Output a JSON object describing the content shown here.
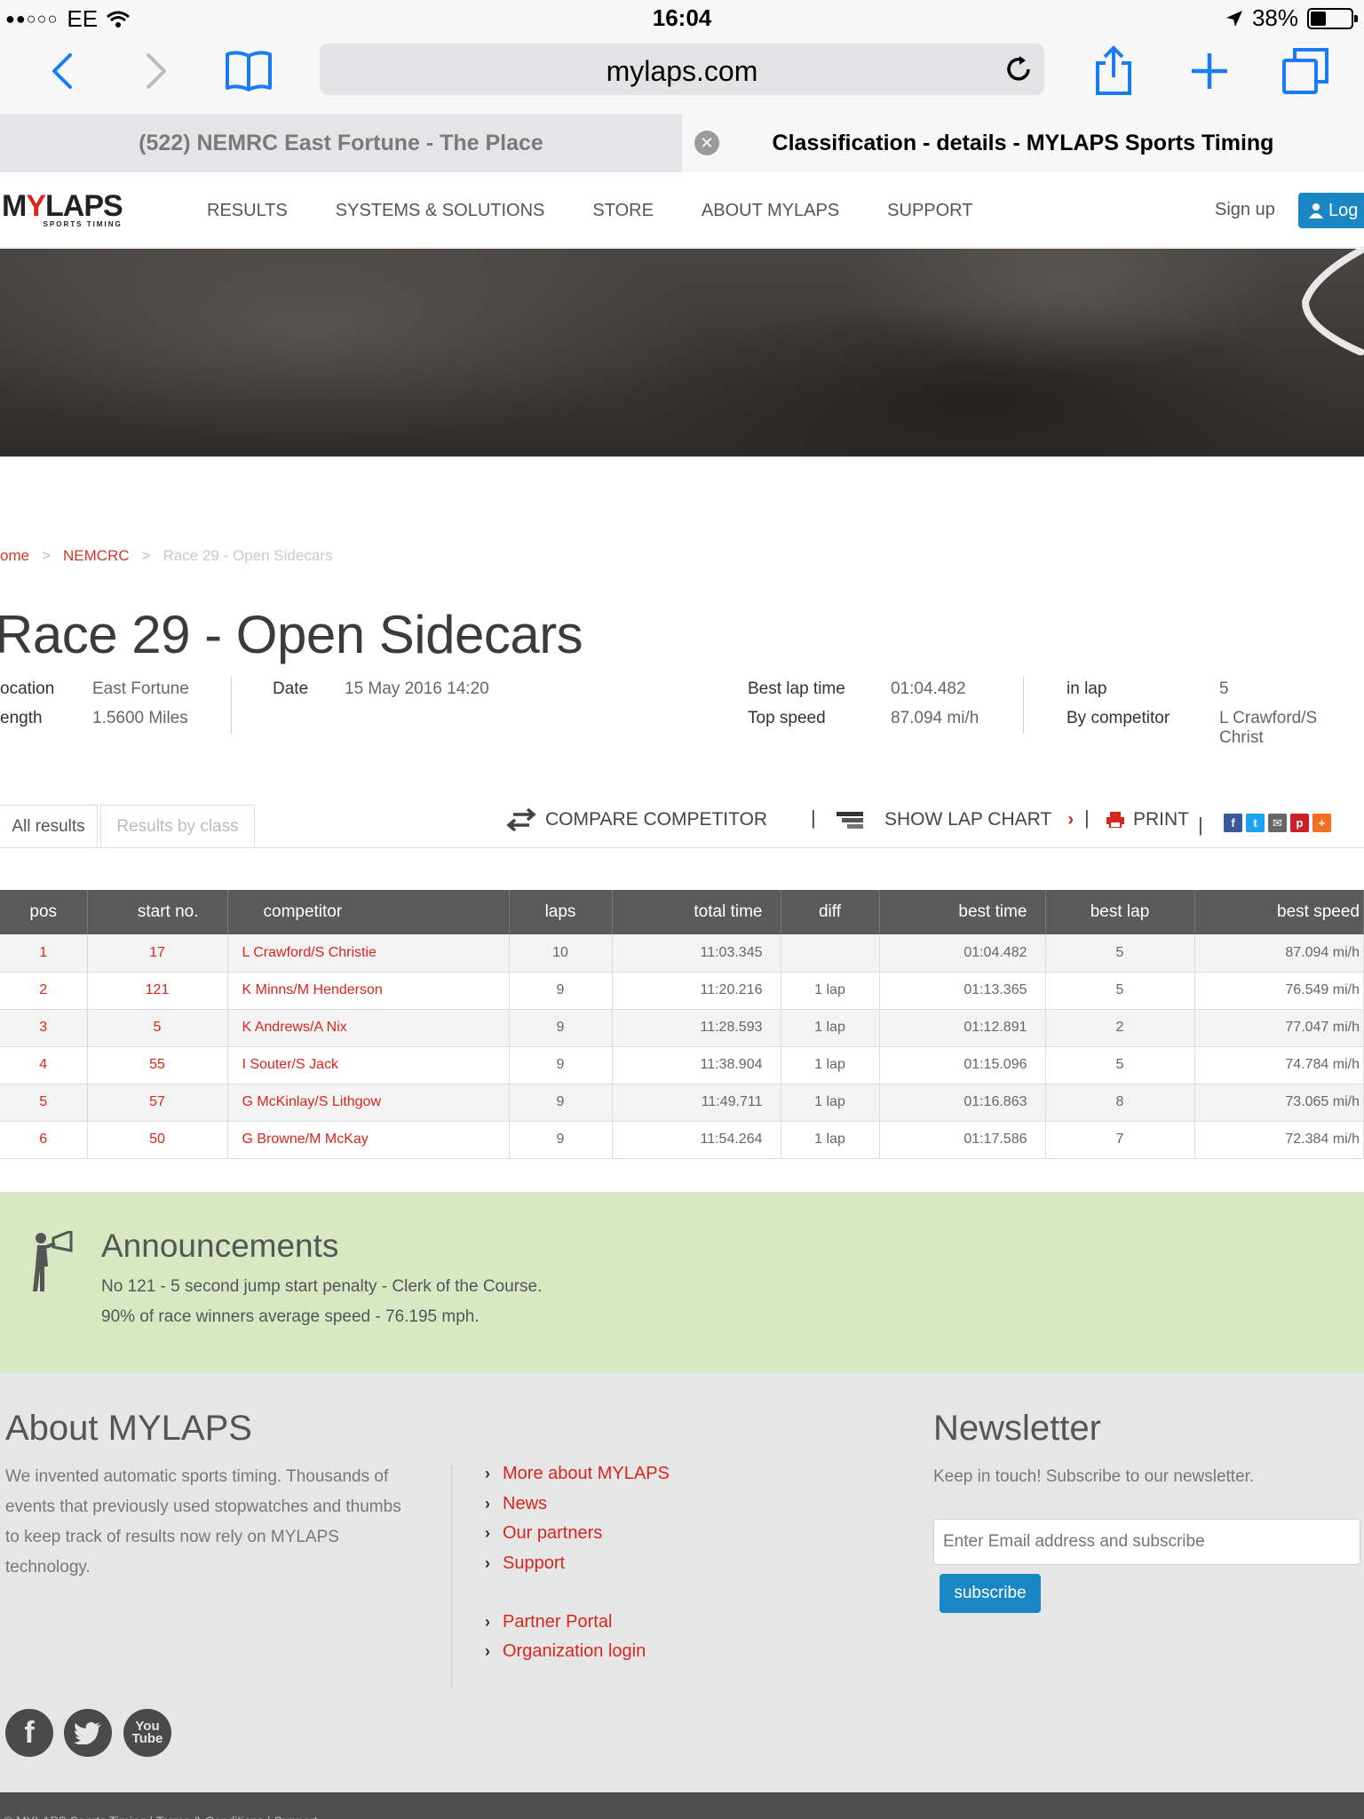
{
  "status": {
    "carrier": "EE",
    "time": "16:04",
    "battery": "38%",
    "battery_level": 0.38
  },
  "browser": {
    "url": "mylaps.com",
    "tabs": [
      {
        "title": "(522) NEMRC East Fortune - The Place"
      },
      {
        "title": "Classification - details - MYLAPS Sports Timing"
      }
    ]
  },
  "site": {
    "logo": "MYLAPS",
    "logo_sub": "SPORTS TIMING",
    "nav": [
      "RESULTS",
      "SYSTEMS & SOLUTIONS",
      "STORE",
      "ABOUT MYLAPS",
      "SUPPORT"
    ],
    "signup": "Sign up",
    "login": "Log"
  },
  "breadcrumb": [
    "ome",
    "NEMCRC",
    "Race 29 - Open Sidecars"
  ],
  "race": {
    "title": "Race 29 - Open Sidecars",
    "location_label": "ocation",
    "location": "East Fortune",
    "length_label": "ength",
    "length": "1.5600 Miles",
    "date_label": "Date",
    "date": "15 May 2016 14:20",
    "best_lap_label": "Best lap time",
    "best_lap": "01:04.482",
    "top_speed_label": "Top speed",
    "top_speed": "87.094 mi/h",
    "in_lap_label": "in lap",
    "in_lap": "5",
    "by_label": "By competitor",
    "by": "L Crawford/S Christ"
  },
  "result_tabs": {
    "all": "All results",
    "by_class": "Results by class"
  },
  "actions": {
    "compare": "COMPARE COMPETITOR",
    "lap_chart": "SHOW LAP CHART",
    "print": "PRINT"
  },
  "table": {
    "headers": [
      "pos",
      "start no.",
      "competitor",
      "laps",
      "total time",
      "diff",
      "best time",
      "best lap",
      "best speed"
    ],
    "rows": [
      {
        "pos": "1",
        "start": "17",
        "competitor": "L Crawford/S Christie",
        "laps": "10",
        "total": "11:03.345",
        "diff": "",
        "best_time": "01:04.482",
        "best_lap": "5",
        "best_speed": "87.094 mi/h"
      },
      {
        "pos": "2",
        "start": "121",
        "competitor": "K Minns/M Henderson",
        "laps": "9",
        "total": "11:20.216",
        "diff": "1 lap",
        "best_time": "01:13.365",
        "best_lap": "5",
        "best_speed": "76.549 mi/h"
      },
      {
        "pos": "3",
        "start": "5",
        "competitor": "K Andrews/A Nix",
        "laps": "9",
        "total": "11:28.593",
        "diff": "1 lap",
        "best_time": "01:12.891",
        "best_lap": "2",
        "best_speed": "77.047 mi/h"
      },
      {
        "pos": "4",
        "start": "55",
        "competitor": "I Souter/S Jack",
        "laps": "9",
        "total": "11:38.904",
        "diff": "1 lap",
        "best_time": "01:15.096",
        "best_lap": "5",
        "best_speed": "74.784 mi/h"
      },
      {
        "pos": "5",
        "start": "57",
        "competitor": "G McKinlay/S Lithgow",
        "laps": "9",
        "total": "11:49.711",
        "diff": "1 lap",
        "best_time": "01:16.863",
        "best_lap": "8",
        "best_speed": "73.065 mi/h"
      },
      {
        "pos": "6",
        "start": "50",
        "competitor": "G Browne/M McKay",
        "laps": "9",
        "total": "11:54.264",
        "diff": "1 lap",
        "best_time": "01:17.586",
        "best_lap": "7",
        "best_speed": "72.384 mi/h"
      }
    ]
  },
  "announcements": {
    "title": "Announcements",
    "lines": [
      "No 121 - 5 second jump start penalty - Clerk of the Course.",
      "90% of race winners average speed - 76.195 mph."
    ]
  },
  "footer": {
    "about_title": "About MYLAPS",
    "about_text": "We invented automatic sports timing. Thousands of events that previously used stopwatches and thumbs to keep track of results now rely on MYLAPS technology.",
    "links": [
      "More about MYLAPS",
      "News",
      "Our partners",
      "Support",
      "Partner Portal",
      "Organization login"
    ],
    "newsletter_title": "Newsletter",
    "newsletter_text": "Keep in touch! Subscribe to our newsletter.",
    "email_placeholder": "Enter Email address and subscribe",
    "subscribe": "subscribe",
    "bottom": "© MYLAPS Sports Timing  |  Terms & Conditions  |  Support"
  },
  "colors": {
    "accent_red": "#d9261c",
    "accent_blue": "#1a87c4",
    "announce_bg": "#d7e8c3",
    "ios_blue": "#1a7cf5"
  }
}
